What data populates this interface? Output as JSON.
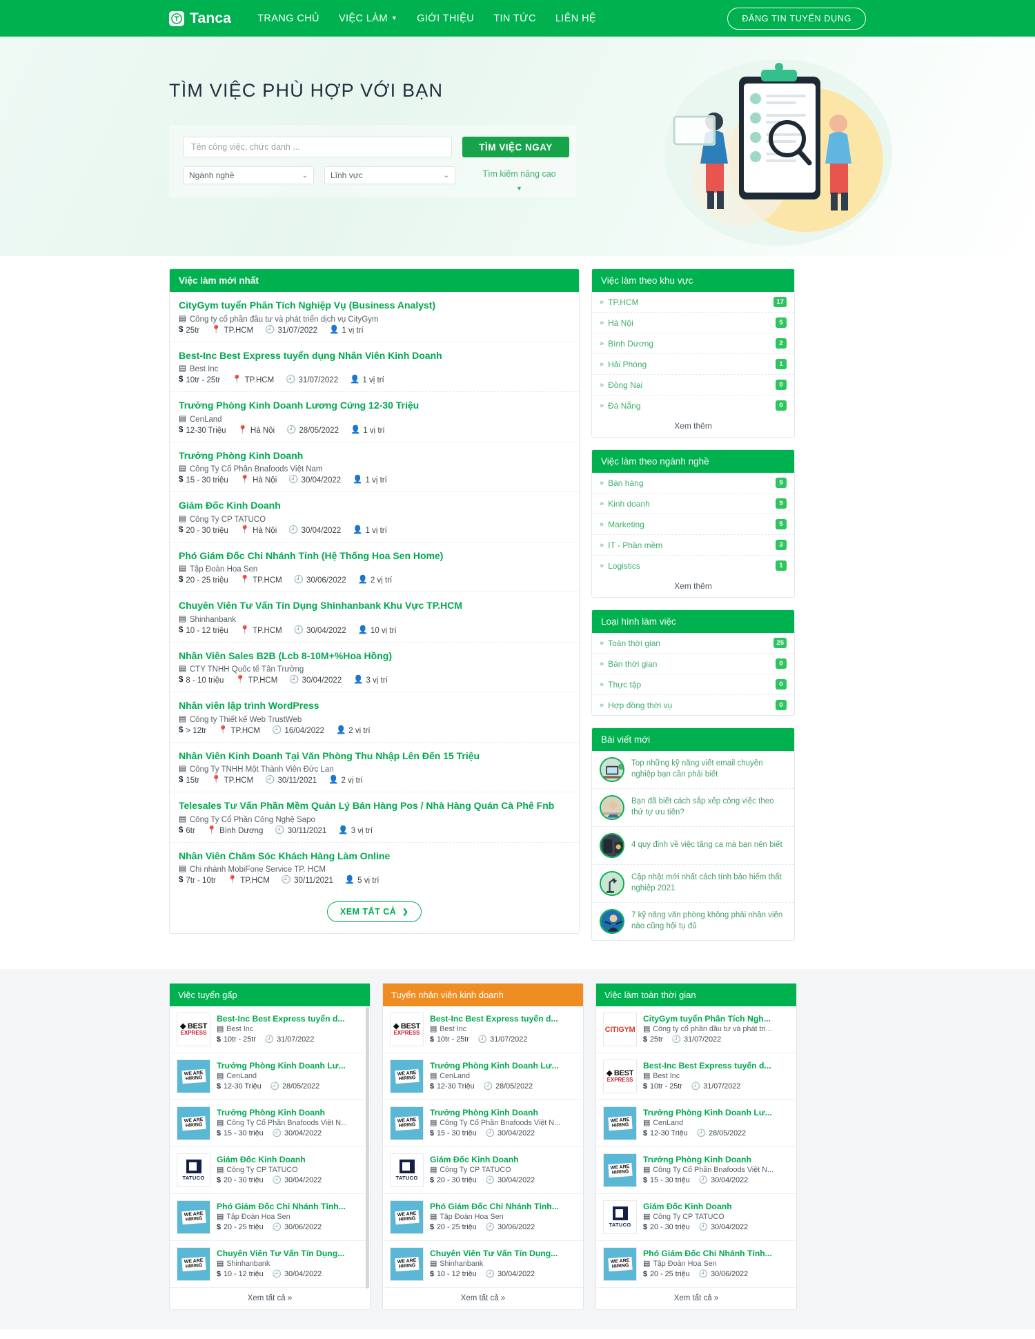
{
  "header": {
    "brand": "Tanca",
    "nav": [
      {
        "label": "TRANG CHỦ",
        "has_caret": false
      },
      {
        "label": "VIỆC LÀM",
        "has_caret": true
      },
      {
        "label": "GIỚI THIỆU",
        "has_caret": false
      },
      {
        "label": "TIN TỨC",
        "has_caret": false
      },
      {
        "label": "LIÊN HỆ",
        "has_caret": false
      }
    ],
    "cta": "ĐĂNG TIN TUYỂN DỤNG",
    "accent_color": "#00b14f"
  },
  "hero": {
    "title": "TÌM VIỆC PHÙ HỢP VỚI BẠN",
    "search_placeholder": "Tên công việc, chức danh ...",
    "search_value": "",
    "search_button": "TÌM VIỆC NGAY",
    "select_industry": "Ngành nghề",
    "select_field": "Lĩnh vực",
    "advanced": "Tìm kiếm nâng cao"
  },
  "latest_jobs": {
    "heading": "Việc làm mới nhất",
    "view_all": "XEM TẤT CẢ",
    "items": [
      {
        "title": "CityGym tuyển Phân Tích Nghiệp Vụ (Business Analyst)",
        "company": "Công ty cổ phần đầu tư và phát triển dịch vụ CityGym",
        "salary": "25tr",
        "location": "TP.HCM",
        "date": "31/07/2022",
        "slots": "1 vị trí"
      },
      {
        "title": "Best-Inc Best Express tuyển dụng Nhân Viên Kinh Doanh",
        "company": "Best Inc",
        "salary": "10tr - 25tr",
        "location": "TP.HCM",
        "date": "31/07/2022",
        "slots": "1 vị trí"
      },
      {
        "title": "Trưởng Phòng Kinh Doanh Lương Cứng 12-30 Triệu",
        "company": "CenLand",
        "salary": "12-30 Triệu",
        "location": "Hà Nội",
        "date": "28/05/2022",
        "slots": "1 vị trí"
      },
      {
        "title": "Trưởng Phòng Kinh Doanh",
        "company": "Công Ty Cổ Phần Bnafoods Việt Nam",
        "salary": "15 - 30 triệu",
        "location": "Hà Nội",
        "date": "30/04/2022",
        "slots": "1 vị trí"
      },
      {
        "title": "Giám Đốc Kinh Doanh",
        "company": "Công Ty CP TATUCO",
        "salary": "20 - 30 triệu",
        "location": "Hà Nội",
        "date": "30/04/2022",
        "slots": "1 vị trí"
      },
      {
        "title": "Phó Giám Đốc Chi Nhánh Tỉnh (Hệ Thống Hoa Sen Home)",
        "company": "Tập Đoàn Hoa Sen",
        "salary": "20 - 25 triệu",
        "location": "TP.HCM",
        "date": "30/06/2022",
        "slots": "2 vị trí"
      },
      {
        "title": "Chuyên Viên Tư Vấn Tín Dụng Shinhanbank Khu Vực TP.HCM",
        "company": "Shinhanbank",
        "salary": "10 - 12 triệu",
        "location": "TP.HCM",
        "date": "30/04/2022",
        "slots": "10 vị trí"
      },
      {
        "title": "Nhân Viên Sales B2B (Lcb 8-10M+%Hoa Hồng)",
        "company": "CTY TNHH Quốc tế Tân Trường",
        "salary": "8 - 10 triệu",
        "location": "TP.HCM",
        "date": "30/04/2022",
        "slots": "3 vị trí"
      },
      {
        "title": "Nhân viên lập trình WordPress",
        "company": "Công ty Thiết kế Web TrustWeb",
        "salary": "> 12tr",
        "location": "TP.HCM",
        "date": "16/04/2022",
        "slots": "2 vị trí"
      },
      {
        "title": "Nhân Viên Kinh Doanh Tại Văn Phòng Thu Nhập Lên Đến 15 Triệu",
        "company": "Công Ty TNHH Một Thành Viên Đức Lan",
        "salary": "15tr",
        "location": "TP.HCM",
        "date": "30/11/2021",
        "slots": "2 vị trí"
      },
      {
        "title": "Telesales Tư Vấn Phần Mềm Quản Lý Bán Hàng Pos / Nhà Hàng Quán Cà Phê Fnb",
        "company": "Công Ty Cổ Phần Công Nghệ Sapo",
        "salary": "6tr",
        "location": "Bình Dương",
        "date": "30/11/2021",
        "slots": "3 vị trí"
      },
      {
        "title": "Nhân Viên Chăm Sóc Khách Hàng Làm Online",
        "company": "Chi nhánh MobiFone Service TP. HCM",
        "salary": "7tr - 10tr",
        "location": "TP.HCM",
        "date": "30/11/2021",
        "slots": "5 vị trí"
      }
    ]
  },
  "by_area": {
    "heading": "Việc làm theo khu vực",
    "more": "Xem thêm",
    "items": [
      {
        "label": "TP.HCM",
        "count": "17"
      },
      {
        "label": "Hà Nội",
        "count": "5"
      },
      {
        "label": "Bình Dương",
        "count": "2"
      },
      {
        "label": "Hải Phòng",
        "count": "1"
      },
      {
        "label": "Đồng Nai",
        "count": "0"
      },
      {
        "label": "Đà Nẵng",
        "count": "0"
      }
    ]
  },
  "by_industry": {
    "heading": "Việc làm theo ngành nghề",
    "more": "Xem thêm",
    "items": [
      {
        "label": "Bán hàng",
        "count": "9"
      },
      {
        "label": "Kinh doanh",
        "count": "9"
      },
      {
        "label": "Marketing",
        "count": "5"
      },
      {
        "label": "IT - Phần mềm",
        "count": "3"
      },
      {
        "label": "Logistics",
        "count": "1"
      }
    ]
  },
  "by_type": {
    "heading": "Loại hình làm việc",
    "items": [
      {
        "label": "Toàn thời gian",
        "count": "25"
      },
      {
        "label": "Bán thời gian",
        "count": "0"
      },
      {
        "label": "Thực tập",
        "count": "0"
      },
      {
        "label": "Hợp đồng thời vụ",
        "count": "0"
      }
    ]
  },
  "blog": {
    "heading": "Bài viết mới",
    "items": [
      {
        "title": "Top những kỹ năng viết email chuyên nghiệp bạn cần phải biết",
        "thumb": "desk-computer-photo"
      },
      {
        "title": "Bạn đã biết cách sắp xếp công việc theo thứ tự ưu tiên?",
        "thumb": "person-working-photo"
      },
      {
        "title": "4 quy định về việc tăng ca mà bạn nên biết",
        "thumb": "office-night-photo"
      },
      {
        "title": "Cập nhật mới nhất cách tính bảo hiểm thất nghiệp 2021",
        "thumb": "lamp-desk-photo"
      },
      {
        "title": "7 kỹ năng văn phòng không phải nhân viên nào cũng hội tụ đủ",
        "thumb": "businessman-arms-photo"
      }
    ]
  },
  "bottom": {
    "urgent": {
      "heading": "Việc tuyển gấp",
      "footer": "Xem tất cả »",
      "items": [
        {
          "title": "Best-Inc Best Express tuyển d...",
          "company": "Best Inc",
          "salary": "10tr - 25tr",
          "date": "31/07/2022",
          "logo": "best-express-logo"
        },
        {
          "title": "Trưởng Phòng Kinh Doanh Lư...",
          "company": "CenLand",
          "salary": "12-30 Triệu",
          "date": "28/05/2022",
          "logo": "we-are-hiring-logo"
        },
        {
          "title": "Trưởng Phòng Kinh Doanh",
          "company": "Công Ty Cổ Phần Bnafoods Việt N...",
          "salary": "15 - 30 triệu",
          "date": "30/04/2022",
          "logo": "we-are-hiring-logo"
        },
        {
          "title": "Giám Đốc Kinh Doanh",
          "company": "Công Ty CP TATUCO",
          "salary": "20 - 30 triệu",
          "date": "30/04/2022",
          "logo": "tatuco-logo"
        },
        {
          "title": "Phó Giám Đốc Chi Nhánh Tỉnh...",
          "company": "Tập Đoàn Hoa Sen",
          "salary": "20 - 25 triệu",
          "date": "30/06/2022",
          "logo": "we-are-hiring-logo"
        },
        {
          "title": "Chuyên Viên Tư Vấn Tín Dụng...",
          "company": "Shinhanbank",
          "salary": "10 - 12 triệu",
          "date": "30/04/2022",
          "logo": "we-are-hiring-logo"
        }
      ]
    },
    "sales": {
      "heading": "Tuyển nhân viên kinh doanh",
      "footer": "Xem tất cả »",
      "items": [
        {
          "title": "Best-Inc Best Express tuyển d...",
          "company": "Best Inc",
          "salary": "10tr - 25tr",
          "date": "31/07/2022",
          "logo": "best-express-logo"
        },
        {
          "title": "Trưởng Phòng Kinh Doanh Lư...",
          "company": "CenLand",
          "salary": "12-30 Triệu",
          "date": "28/05/2022",
          "logo": "we-are-hiring-logo"
        },
        {
          "title": "Trưởng Phòng Kinh Doanh",
          "company": "Công Ty Cổ Phần Bnafoods Việt N...",
          "salary": "15 - 30 triệu",
          "date": "30/04/2022",
          "logo": "we-are-hiring-logo"
        },
        {
          "title": "Giám Đốc Kinh Doanh",
          "company": "Công Ty CP TATUCO",
          "salary": "20 - 30 triệu",
          "date": "30/04/2022",
          "logo": "tatuco-logo"
        },
        {
          "title": "Phó Giám Đốc Chi Nhánh Tỉnh...",
          "company": "Tập Đoàn Hoa Sen",
          "salary": "20 - 25 triệu",
          "date": "30/06/2022",
          "logo": "we-are-hiring-logo"
        },
        {
          "title": "Chuyên Viên Tư Vấn Tín Dụng...",
          "company": "Shinhanbank",
          "salary": "10 - 12 triệu",
          "date": "30/04/2022",
          "logo": "we-are-hiring-logo"
        }
      ]
    },
    "fulltime": {
      "heading": "Việc làm toàn thời gian",
      "footer": "Xem tất cả »",
      "items": [
        {
          "title": "CityGym tuyển Phân Tích Ngh...",
          "company": "Công ty cổ phần đầu tư và phát tri...",
          "salary": "25tr",
          "date": "31/07/2022",
          "logo": "citygym-logo"
        },
        {
          "title": "Best-Inc Best Express tuyển d...",
          "company": "Best Inc",
          "salary": "10tr - 25tr",
          "date": "31/07/2022",
          "logo": "best-express-logo"
        },
        {
          "title": "Trưởng Phòng Kinh Doanh Lư...",
          "company": "CenLand",
          "salary": "12-30 Triệu",
          "date": "28/05/2022",
          "logo": "we-are-hiring-logo"
        },
        {
          "title": "Trưởng Phòng Kinh Doanh",
          "company": "Công Ty Cổ Phần Bnafoods Việt N...",
          "salary": "15 - 30 triệu",
          "date": "30/04/2022",
          "logo": "we-are-hiring-logo"
        },
        {
          "title": "Giám Đốc Kinh Doanh",
          "company": "Công Ty CP TATUCO",
          "salary": "20 - 30 triệu",
          "date": "30/04/2022",
          "logo": "tatuco-logo"
        },
        {
          "title": "Phó Giám Đốc Chi Nhánh Tỉnh...",
          "company": "Tập Đoàn Hoa Sen",
          "salary": "20 - 25 triệu",
          "date": "30/06/2022",
          "logo": "we-are-hiring-logo"
        }
      ]
    }
  }
}
